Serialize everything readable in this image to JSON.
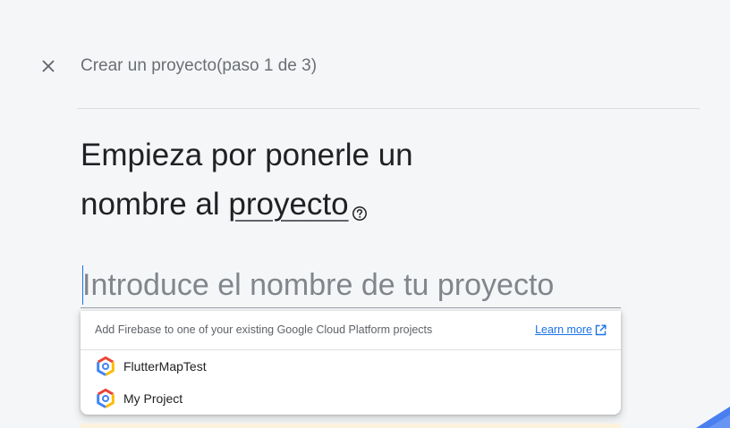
{
  "header": {
    "title": "Crear un proyecto(paso 1 de 3)",
    "close_icon": "close-icon"
  },
  "headline": {
    "line1": "Empieza por ponerle un",
    "line2_prefix": "nombre al ",
    "term": "proyecto",
    "help_icon": "help-circle-icon"
  },
  "project_name_field": {
    "value": "",
    "placeholder": "Introduce el nombre de tu proyecto"
  },
  "dropdown": {
    "hint": "Add Firebase to one of your existing Google Cloud Platform projects",
    "learn_more": "Learn more",
    "learn_more_icon": "open-in-new-icon",
    "projects": [
      {
        "name": "FlutterMapTest",
        "icon": "google-cloud-icon"
      },
      {
        "name": "My Project",
        "icon": "google-cloud-icon"
      }
    ]
  },
  "colors": {
    "background": "#f5f6f8",
    "link": "#1a73e8",
    "text_primary": "#202124",
    "text_secondary": "#5f6368",
    "banner": "#fdf2dd",
    "decor_blue": "#4a7ff0"
  }
}
